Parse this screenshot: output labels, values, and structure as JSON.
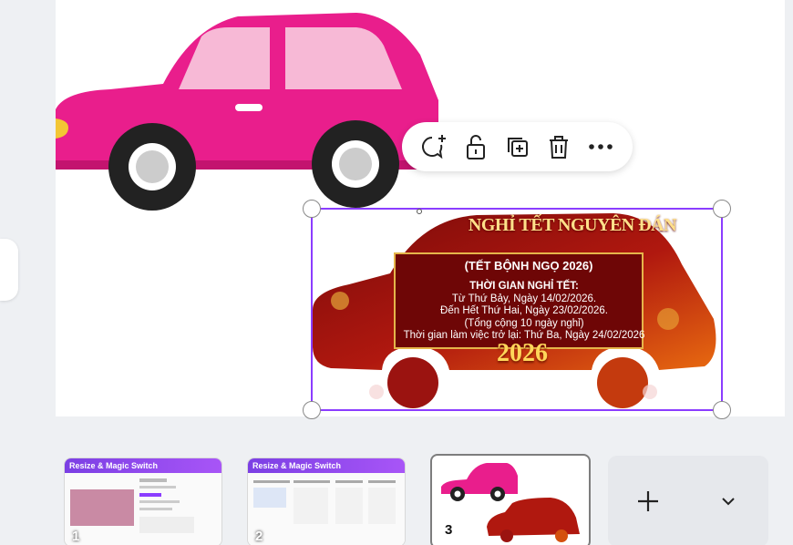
{
  "toolbar": {
    "icons": [
      "comment-add-icon",
      "lock-icon",
      "duplicate-icon",
      "trash-icon",
      "more-icon"
    ]
  },
  "selected_element": {
    "title": "NGHỈ TẾT NGUYÊN ĐÁN",
    "subtitle": "(TẾT BỘNH NGỌ 2026)",
    "line1": "THỜI GIAN NGHỈ TẾT:",
    "line2": "Từ Thứ Bảy, Ngày 14/02/2026.",
    "line3": "Đến Hết Thứ Hai, Ngày 23/02/2026.",
    "line4": "(Tổng cộng 10 ngày nghỉ)",
    "line5": "Thời gian làm việc trở lại: Thứ Ba, Ngày 24/02/2026",
    "year": "2026"
  },
  "pages": [
    {
      "number": "1",
      "title": "Resize & Magic Switch"
    },
    {
      "number": "2",
      "title": "Resize & Magic Switch"
    },
    {
      "number": "3",
      "title": ""
    }
  ],
  "page_controls": {
    "add_icon": "plus-icon",
    "expand_icon": "chevron-down-icon"
  },
  "colors": {
    "accent": "#8b3dff",
    "car_pink": "#e91e8c",
    "tet_red": "#8b0a0a"
  }
}
